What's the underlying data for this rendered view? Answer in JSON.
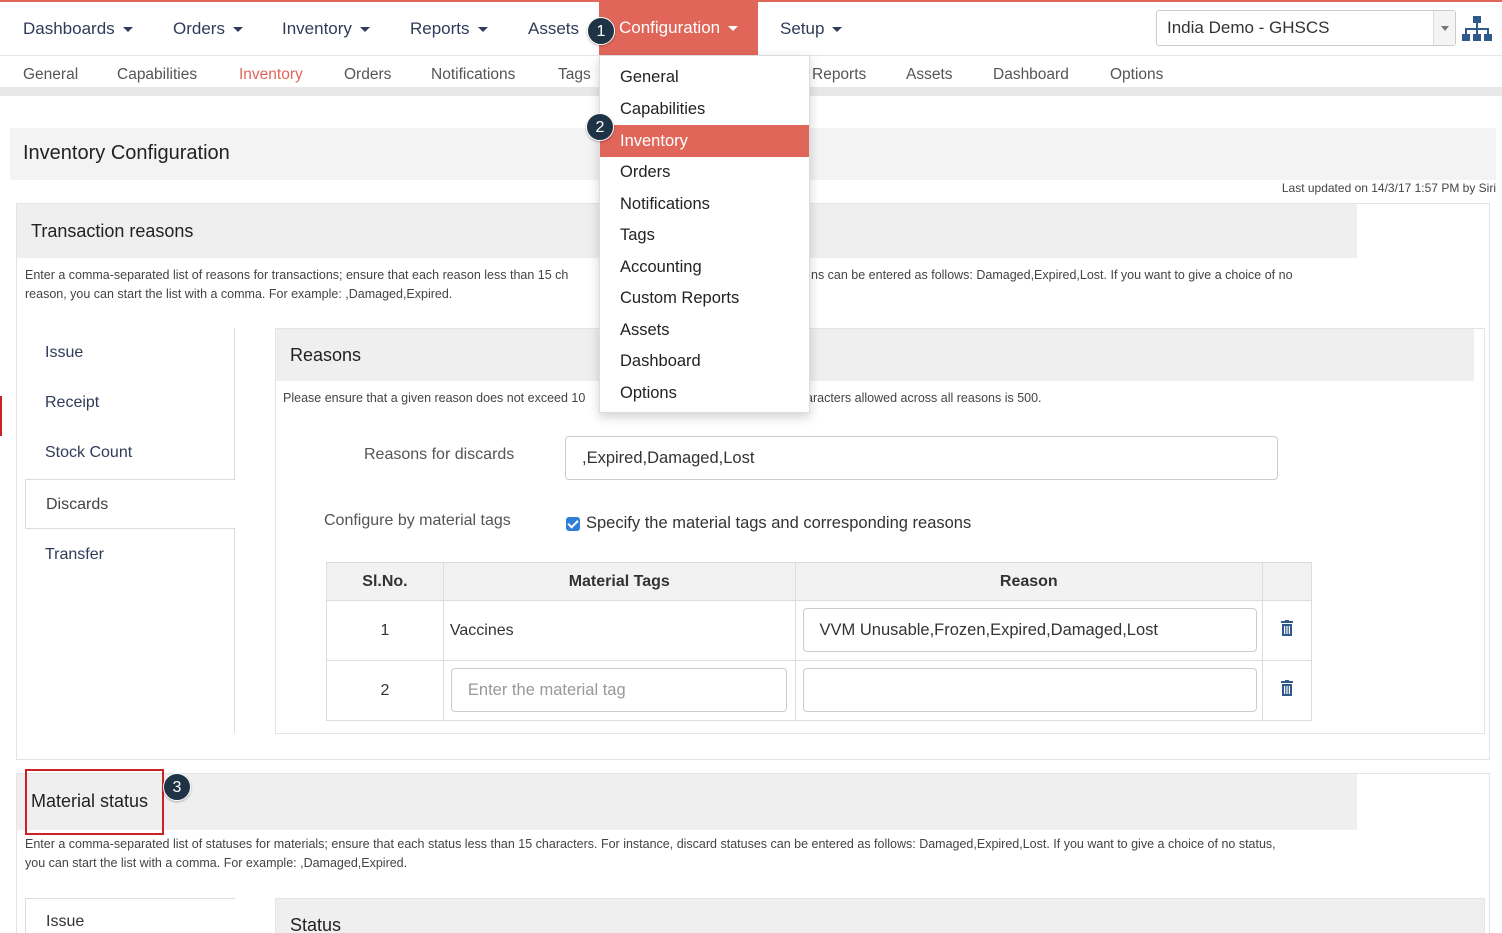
{
  "topnav": {
    "items": [
      {
        "label": "Dashboards"
      },
      {
        "label": "Orders"
      },
      {
        "label": "Inventory"
      },
      {
        "label": "Reports"
      },
      {
        "label": "Assets"
      },
      {
        "label": "Configuration"
      },
      {
        "label": "Setup"
      }
    ],
    "active": "Configuration",
    "domain": "India Demo - GHSCS",
    "hierarchy_icon": "hierarchy-icon"
  },
  "subnav": {
    "items": [
      "General",
      "Capabilities",
      "Inventory",
      "Orders",
      "Notifications",
      "Tags",
      "Reports",
      "Assets",
      "Dashboard",
      "Options"
    ],
    "active": "Inventory"
  },
  "page": {
    "title": "Inventory Configuration",
    "last_updated": "Last updated on 14/3/17 1:57 PM by Siri"
  },
  "transaction_reasons": {
    "title": "Transaction reasons",
    "desc_line1": "Enter a comma-separated list of reasons for transactions; ensure that each reason less than 15 ch",
    "desc_line1_tail": "ns can be entered as follows: Damaged,Expired,Lost. If you want to give a choice of no",
    "desc_line2": "reason, you can start the list with a comma. For example: ,Damaged,Expired.",
    "tabs": [
      "Issue",
      "Receipt",
      "Stock Count",
      "Discards",
      "Transfer"
    ],
    "active_tab": "Discards",
    "reasons": {
      "title": "Reasons",
      "desc_left": "Please ensure that a given reason does not exceed 10",
      "desc_right": "aracters allowed across all reasons is 500.",
      "discards_label": "Reasons for discards",
      "discards_value": ",Expired,Damaged,Lost",
      "configure_label": "Configure by material tags",
      "checkbox_label": "Specify the material tags and corresponding reasons",
      "table": {
        "headers": [
          "Sl.No.",
          "Material Tags",
          "Reason"
        ],
        "rows": [
          {
            "no": "1",
            "tag": "Vaccines",
            "reason": "VVM Unusable,Frozen,Expired,Damaged,Lost"
          },
          {
            "no": "2",
            "tag_placeholder": "Enter the material tag",
            "reason": ""
          }
        ]
      }
    }
  },
  "dropdown": {
    "items": [
      "General",
      "Capabilities",
      "Inventory",
      "Orders",
      "Notifications",
      "Tags",
      "Accounting",
      "Custom Reports",
      "Assets",
      "Dashboard",
      "Options"
    ],
    "active": "Inventory"
  },
  "badges": [
    "1",
    "2",
    "3"
  ],
  "material_status": {
    "title": "Material status",
    "desc_line1": "Enter a comma-separated list of statuses for materials; ensure that each status less than 15 characters. For instance, discard statuses can be entered as follows: Damaged,Expired,Lost. If you want to give a choice of no status,",
    "desc_line2": "you can start the list with a comma. For example: ,Damaged,Expired.",
    "first_tab": "Issue",
    "status_title": "Status"
  },
  "colors": {
    "accent": "#e0665a",
    "nav_text": "#2f3b59",
    "badge": "#1f3346",
    "highlight_box": "#cc2222"
  }
}
